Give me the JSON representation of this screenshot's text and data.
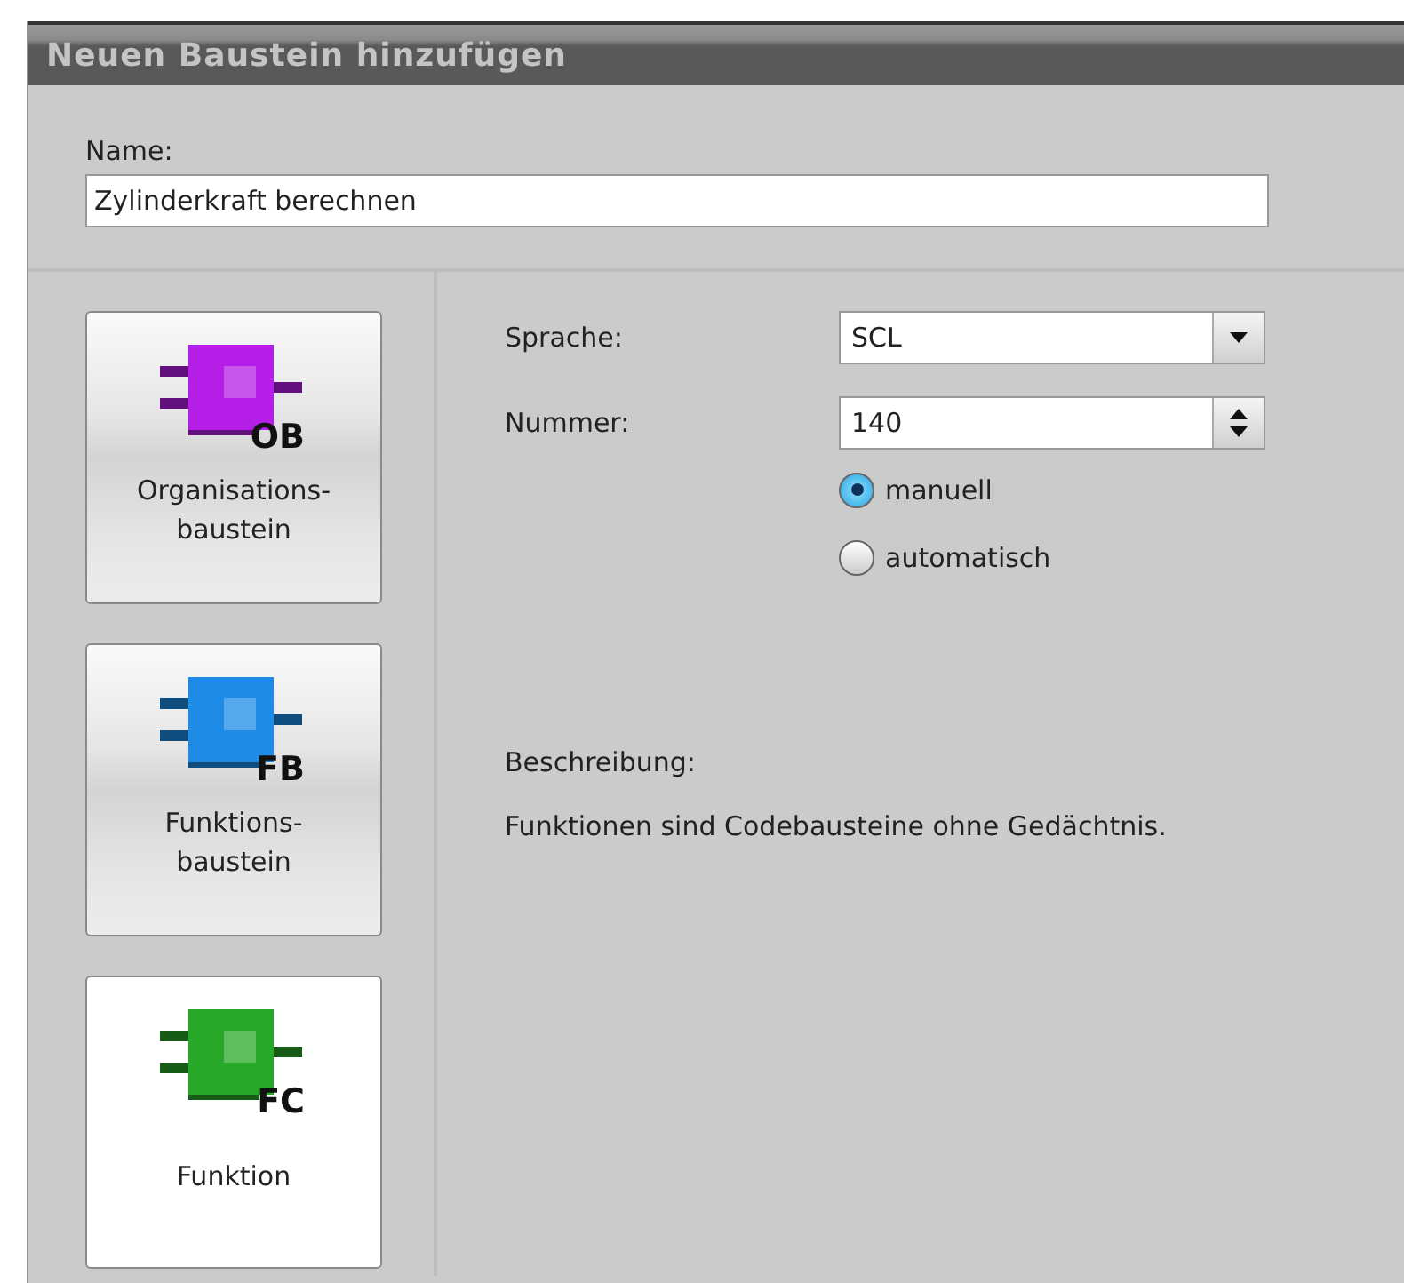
{
  "window": {
    "title": "Neuen Baustein hinzufügen"
  },
  "name_field": {
    "label": "Name:",
    "value": "Zylinderkraft berechnen"
  },
  "block_types": [
    {
      "code": "OB",
      "label": "Organisations-\nbaustein",
      "color": "#b41ee6",
      "selected": false
    },
    {
      "code": "FB",
      "label": "Funktions-\nbaustein",
      "color": "#1e8ce6",
      "selected": false
    },
    {
      "code": "FC",
      "label": "Funktion",
      "color": "#28a828",
      "selected": true
    }
  ],
  "language": {
    "label": "Sprache:",
    "value": "SCL"
  },
  "number": {
    "label": "Nummer:",
    "value": "140"
  },
  "numbering_options": [
    {
      "label": "manuell",
      "selected": true
    },
    {
      "label": "automatisch",
      "selected": false
    }
  ],
  "description": {
    "label": "Beschreibung:",
    "text": "Funktionen sind Codebausteine ohne Gedächtnis."
  }
}
